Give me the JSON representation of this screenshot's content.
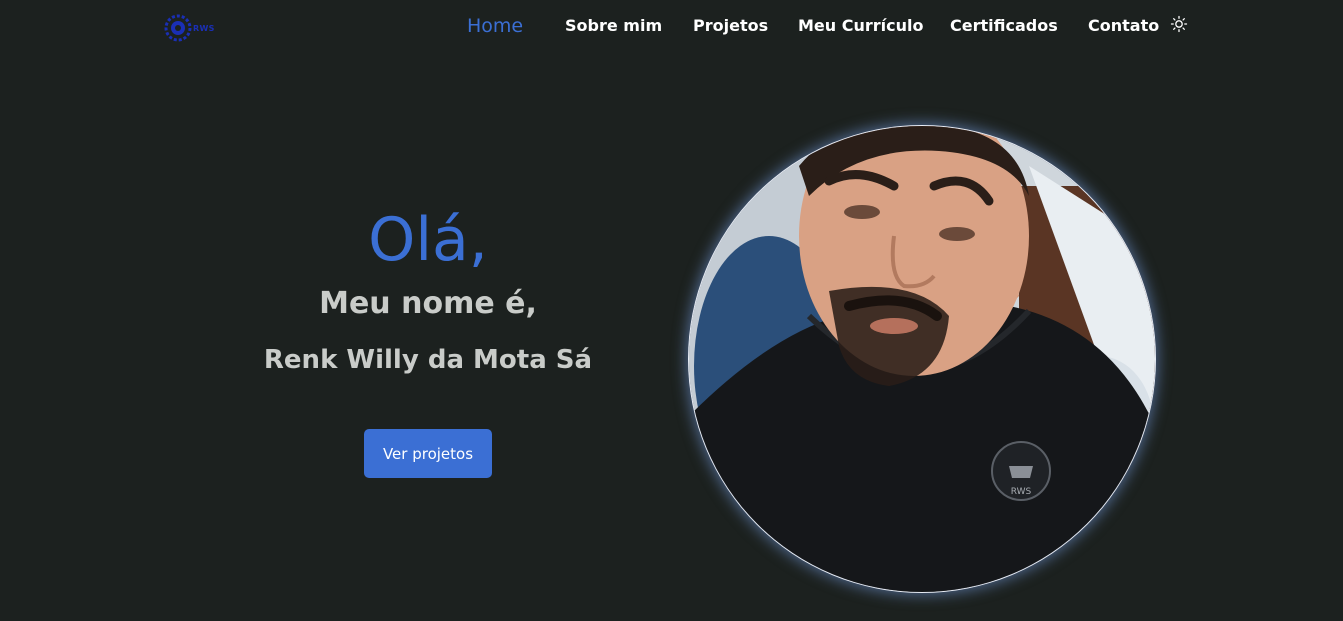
{
  "logo": {
    "text": "RWS",
    "color": "#1a2fb5"
  },
  "nav": {
    "items": [
      {
        "label": "Home",
        "active": true
      },
      {
        "label": "Sobre mim",
        "active": false
      },
      {
        "label": "Projetos",
        "active": false
      },
      {
        "label": "Meu Currículo",
        "active": false
      },
      {
        "label": "Certificados",
        "active": false
      },
      {
        "label": "Contato",
        "active": false
      }
    ],
    "theme_toggle_icon": "sun-icon"
  },
  "hero": {
    "greeting": "Olá,",
    "subtitle": "Meu nome é,",
    "name": "Renk Willy da Mota Sá",
    "cta_label": "Ver projetos"
  },
  "photo": {
    "badge_text": "RWS",
    "icon": "profile-photo"
  },
  "colors": {
    "background": "#1c211f",
    "accent": "#3b6fd4",
    "text_muted": "#c9ccc9",
    "nav_text": "#ffffff"
  }
}
